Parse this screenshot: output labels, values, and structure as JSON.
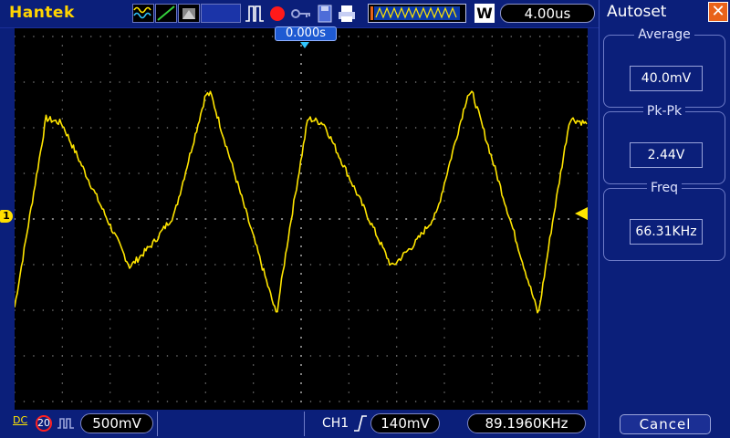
{
  "header": {
    "brand": "Hantek",
    "acquire_mode": "W",
    "timebase": "4.00us"
  },
  "screen": {
    "trigger_position": "0.000s",
    "channel_marker": "1"
  },
  "footer": {
    "coupling": "DC",
    "bandwidth_limit": "20",
    "ch1_scale": "500mV",
    "trigger_source": "CH1",
    "trigger_level": "140mV",
    "frequency": "89.1960KHz"
  },
  "panel": {
    "title": "Autoset",
    "close_symbol": "✕",
    "measurements": [
      {
        "label": "Average",
        "value": "40.0mV"
      },
      {
        "label": "Pk-Pk",
        "value": "2.44V"
      },
      {
        "label": "Freq",
        "value": "66.31KHz"
      }
    ],
    "cancel_label": "Cancel"
  },
  "colors": {
    "trace": "#ffe500",
    "ui_blue": "#0b1f7a",
    "grid": "#7f7f7f",
    "run_indicator": "#ff1a1a"
  },
  "icons": [
    "waveform-icon",
    "trigger-edge-icon",
    "display-icon",
    "pulse-icon",
    "run-stop-icon",
    "key-icon",
    "save-icon",
    "printer-icon",
    "memory-waveform-icon",
    "trigger-rise-icon",
    "ch1-marker-icon",
    "trigger-level-marker-icon"
  ]
}
